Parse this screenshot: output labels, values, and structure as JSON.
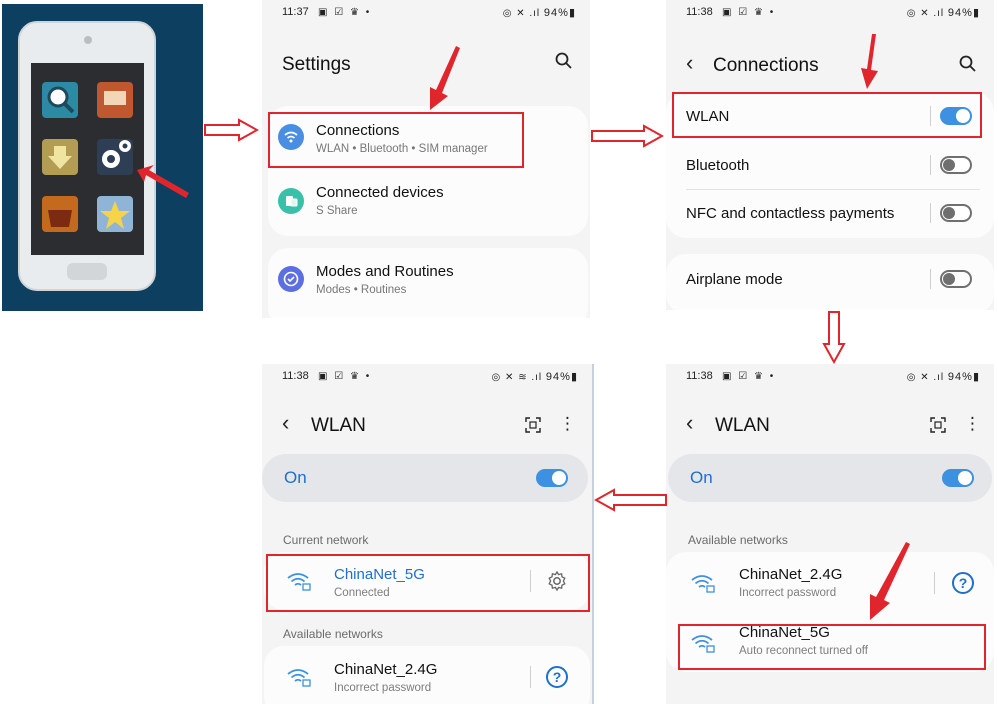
{
  "statusbar": {
    "time_a": "11:37",
    "time_b": "11:38",
    "left_icons": "▣ ☑ ♛ •",
    "right_icons_a": "◎ ✕ .ıl",
    "right_icons_b": "◎ ✕ ≋ .ıl",
    "battery": "94%▮"
  },
  "settings": {
    "title": "Settings",
    "items": [
      {
        "title": "Connections",
        "subtitle": "WLAN  •  Bluetooth  •  SIM manager"
      },
      {
        "title": "Connected devices",
        "subtitle": "S Share"
      },
      {
        "title": "Modes and Routines",
        "subtitle": "Modes  •  Routines"
      }
    ]
  },
  "connections": {
    "title": "Connections",
    "items": [
      {
        "title": "WLAN",
        "state": "on"
      },
      {
        "title": "Bluetooth",
        "state": "off"
      },
      {
        "title": "NFC and contactless payments",
        "state": "off"
      },
      {
        "title": "Airplane mode",
        "state": "off"
      }
    ]
  },
  "wlan_before": {
    "title": "WLAN",
    "on_label": "On",
    "available_label": "Available networks",
    "networks": [
      {
        "name": "ChinaNet_2.4G",
        "status": "Incorrect password"
      },
      {
        "name": "ChinaNet_5G",
        "status": "Auto reconnect turned off"
      }
    ]
  },
  "wlan_after": {
    "title": "WLAN",
    "on_label": "On",
    "current_label": "Current network",
    "current": {
      "name": "ChinaNet_5G",
      "status": "Connected"
    },
    "available_label": "Available networks",
    "networks": [
      {
        "name": "ChinaNet_2.4G",
        "status": "Incorrect password"
      }
    ]
  },
  "colors": {
    "accent": "#3e91e0",
    "link_blue": "#1f6fcc",
    "highlight_red": "#e0262c",
    "phone_bg": "#0d4060"
  },
  "icons": {
    "search": "⌕",
    "back": "‹",
    "more": "⋮",
    "help": "?",
    "gear": "⚙"
  }
}
